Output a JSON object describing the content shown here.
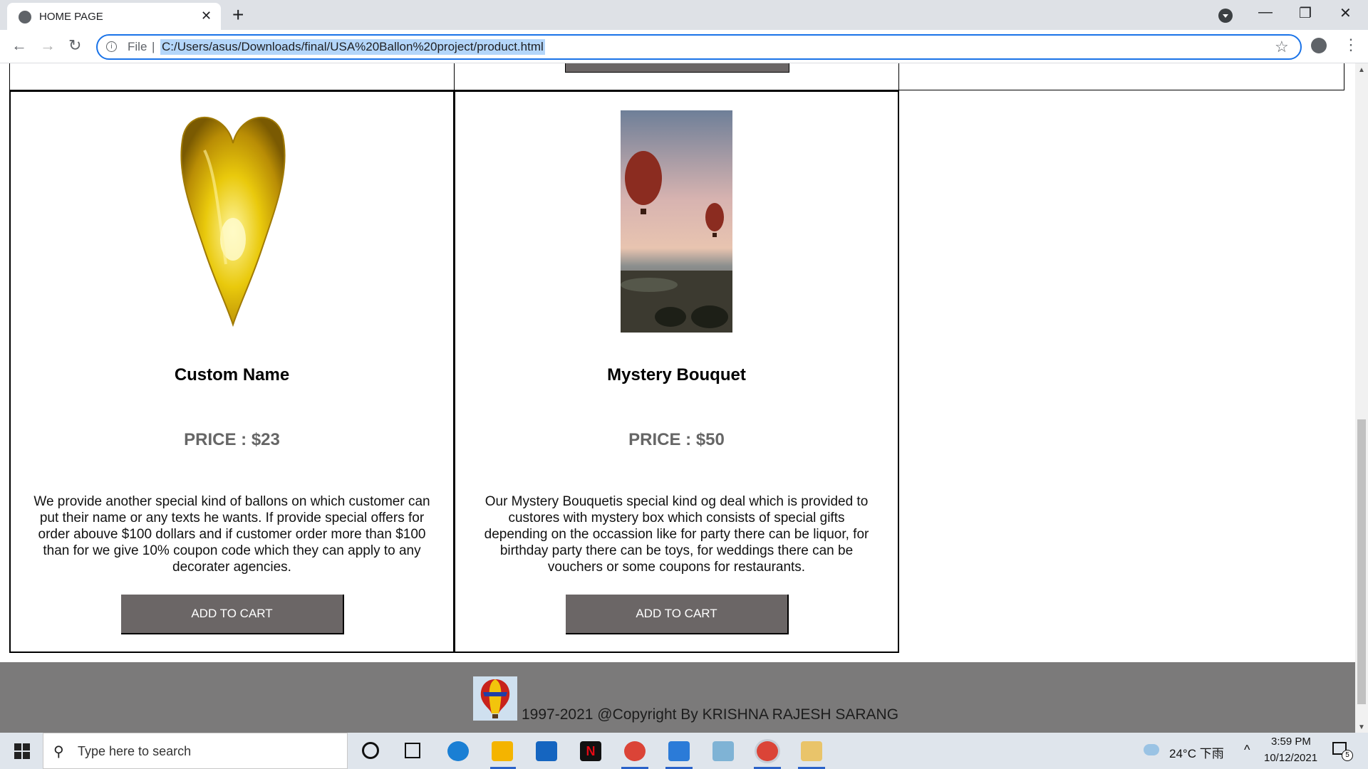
{
  "browser": {
    "tab_title": "HOME PAGE",
    "tab_close": "✕",
    "new_tab": "+",
    "scheme_label": "File",
    "separator": "|",
    "url": "C:/Users/asus/Downloads/final/USA%20Ballon%20project/product.html",
    "info_glyph": "i",
    "back_glyph": "←",
    "forward_glyph": "→",
    "reload_glyph": "↻",
    "star_glyph": "☆",
    "menu_glyph": "⋮",
    "minimize_glyph": "—",
    "maximize_glyph": "❐",
    "close_glyph": "✕"
  },
  "products": [
    {
      "name": "Custom Name",
      "price": "PRICE : $23",
      "description": "We provide another special kind of ballons on which customer can put their name or any texts he wants. If provide special offers for order abouve $100 dollars and if customer order more than $100 than for we give 10% coupon code which they can apply to any decorater agencies.",
      "button": "ADD TO CART",
      "image_icon": "gold-heart-balloon-image"
    },
    {
      "name": "Mystery Bouquet",
      "price": "PRICE : $50",
      "description": "Our Mystery Bouquetis special kind og deal which is provided to custores with mystery box which consists of special gifts depending on the occassion like for party there can be liquor, for birthday party there can be toys, for weddings there can be vouchers or some coupons for restaurants.",
      "button": "ADD TO CART",
      "image_icon": "hot-air-balloons-photo"
    }
  ],
  "footer": {
    "text": "1997-2021 @Copyright By KRISHNA RAJESH SARANG",
    "logo_icon": "hot-air-balloon-logo"
  },
  "taskbar": {
    "search_placeholder": "Type here to search",
    "search_glyph": "⚲",
    "weather": "24°C 下雨",
    "tray_chevron": "^",
    "time": "3:59 PM",
    "date": "10/12/2021",
    "notification_count": "5",
    "netflix_glyph": "N"
  },
  "colors": {
    "button_bg": "#6b6666",
    "footer_bg": "#7b7a7a",
    "price_text": "#666666",
    "url_highlight": "#b4d6fa"
  }
}
